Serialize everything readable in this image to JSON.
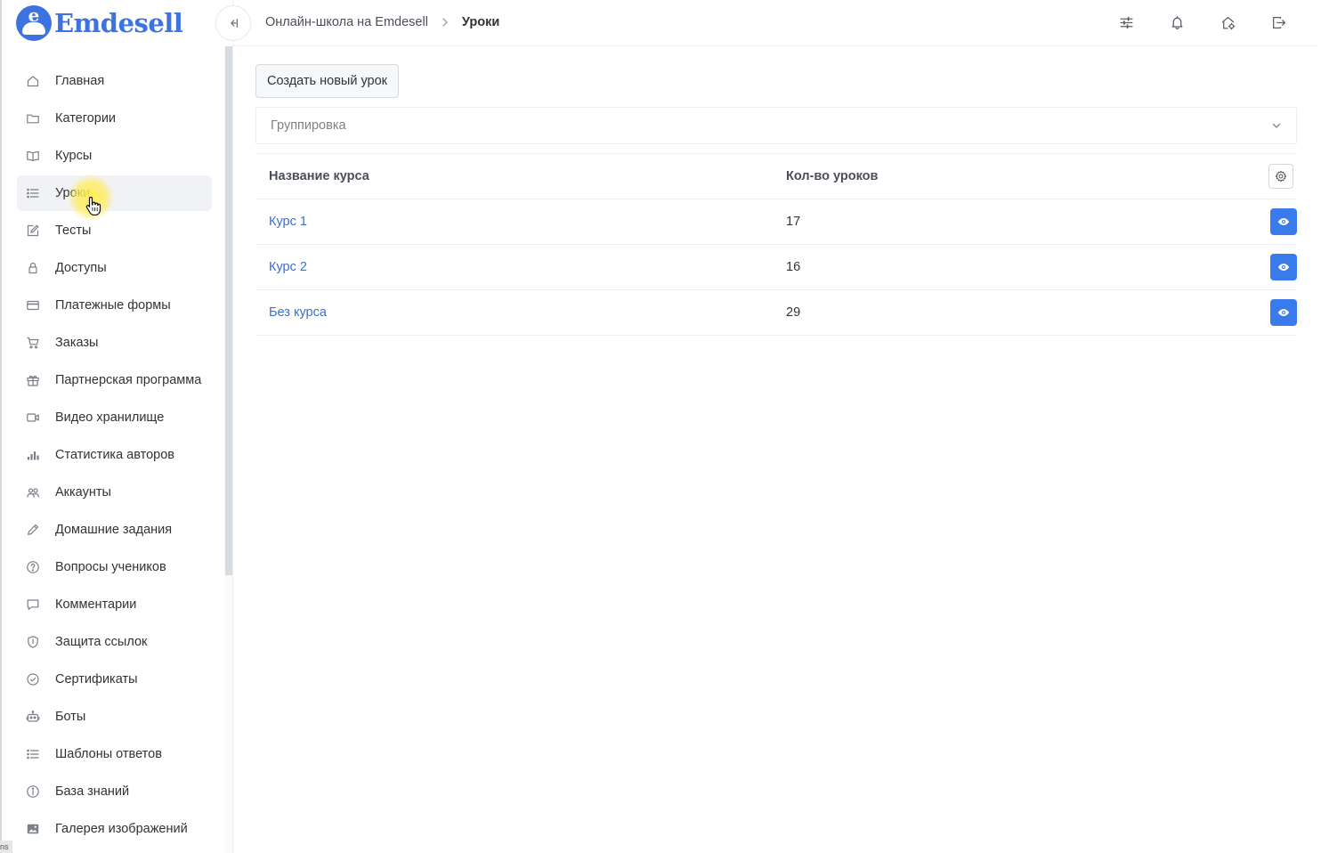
{
  "brand": {
    "name": "Emdesell",
    "badge_letter": "e",
    "color": "#3d73e0"
  },
  "sidebar": {
    "items": [
      {
        "label": "Главная",
        "icon": "home-icon",
        "slug": "home"
      },
      {
        "label": "Категории",
        "icon": "folder-icon",
        "slug": "categories"
      },
      {
        "label": "Курсы",
        "icon": "book-icon",
        "slug": "courses"
      },
      {
        "label": "Уроки",
        "icon": "list-icon",
        "slug": "lessons",
        "active": true
      },
      {
        "label": "Тесты",
        "icon": "edit-icon",
        "slug": "tests"
      },
      {
        "label": "Доступы",
        "icon": "lock-icon",
        "slug": "access"
      },
      {
        "label": "Платежные формы",
        "icon": "credit-card-icon",
        "slug": "payment-forms"
      },
      {
        "label": "Заказы",
        "icon": "cart-icon",
        "slug": "orders"
      },
      {
        "label": "Партнерская программа",
        "icon": "gift-icon",
        "slug": "affiliate"
      },
      {
        "label": "Видео хранилище",
        "icon": "video-icon",
        "slug": "video-storage"
      },
      {
        "label": "Статистика авторов",
        "icon": "bar-chart-icon",
        "slug": "author-stats"
      },
      {
        "label": "Аккаунты",
        "icon": "users-icon",
        "slug": "accounts"
      },
      {
        "label": "Домашние задания",
        "icon": "pencil-icon",
        "slug": "homework"
      },
      {
        "label": "Вопросы учеников",
        "icon": "question-circle-icon",
        "slug": "student-questions"
      },
      {
        "label": "Комментарии",
        "icon": "comment-icon",
        "slug": "comments"
      },
      {
        "label": "Защита ссылок",
        "icon": "shield-icon",
        "slug": "link-protection"
      },
      {
        "label": "Сертификаты",
        "icon": "certificate-icon",
        "slug": "certificates"
      },
      {
        "label": "Боты",
        "icon": "robot-icon",
        "slug": "bots"
      },
      {
        "label": "Шаблоны ответов",
        "icon": "list-icon",
        "slug": "reply-templates"
      },
      {
        "label": "База знаний",
        "icon": "info-circle-icon",
        "slug": "knowledge-base"
      },
      {
        "label": "Галерея изображений",
        "icon": "image-icon",
        "slug": "image-gallery"
      }
    ]
  },
  "header": {
    "breadcrumb": {
      "parent": "Онлайн-школа на Emdesell",
      "current": "Уроки"
    },
    "actions": [
      "sliders-icon",
      "bell-icon",
      "home-settings-icon",
      "logout-icon"
    ]
  },
  "main": {
    "create_button": "Создать новый урок",
    "grouping_placeholder": "Группировка",
    "table": {
      "columns": [
        "Название курса",
        "Кол-во уроков"
      ],
      "rows": [
        {
          "name": "Курс 1",
          "count": "17"
        },
        {
          "name": "Курс 2",
          "count": "16"
        },
        {
          "name": "Без курса",
          "count": "29"
        }
      ]
    }
  },
  "corner_tag": "ns",
  "colors": {
    "accent": "#3a7bec",
    "link": "#3b6fd4",
    "active_bg": "#f1f2f5"
  }
}
